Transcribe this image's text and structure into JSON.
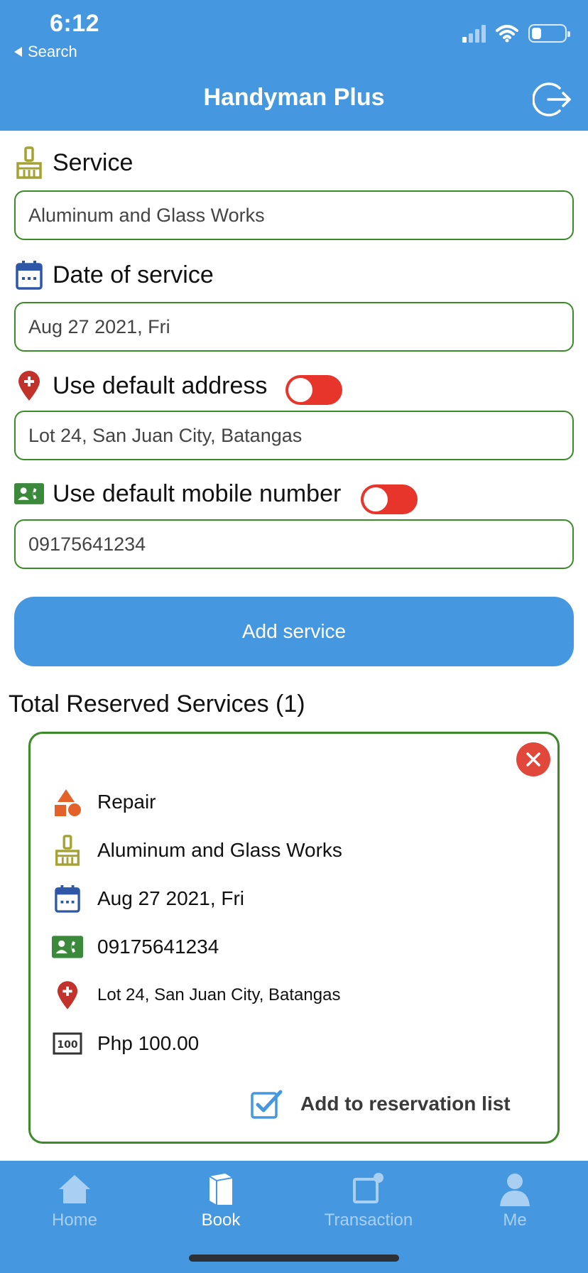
{
  "status_bar": {
    "time": "6:12",
    "back_label": "Search"
  },
  "header": {
    "title": "Handyman Plus"
  },
  "form": {
    "service": {
      "label": "Service",
      "value": "Aluminum and Glass Works"
    },
    "date": {
      "label": "Date of service",
      "value": "Aug 27 2021, Fri"
    },
    "address": {
      "label": "Use default address",
      "value": "Lot 24, San Juan City, Batangas",
      "toggle_on": false
    },
    "mobile": {
      "label": "Use default mobile number",
      "value": "09175641234",
      "toggle_on": false
    },
    "add_button": "Add service"
  },
  "reserved": {
    "title": "Total Reserved Services (1)",
    "card": {
      "category": "Repair",
      "service": "Aluminum and Glass Works",
      "date": "Aug 27 2021, Fri",
      "mobile": "09175641234",
      "address": "Lot 24, San Juan City, Batangas",
      "price": "Php 100.00",
      "add_to_list": "Add to reservation list",
      "add_to_list_checked": true
    }
  },
  "tabs": [
    {
      "label": "Home",
      "icon": "house-icon",
      "active": false
    },
    {
      "label": "Book",
      "icon": "book-icon",
      "active": true
    },
    {
      "label": "Transaction",
      "icon": "transaction-icon",
      "active": false
    },
    {
      "label": "Me",
      "icon": "person-icon",
      "active": false
    }
  ],
  "colors": {
    "primary": "#4597e0",
    "input_border": "#3c8a2a",
    "toggle_off": "#e8352b",
    "close": "#e1473b"
  }
}
